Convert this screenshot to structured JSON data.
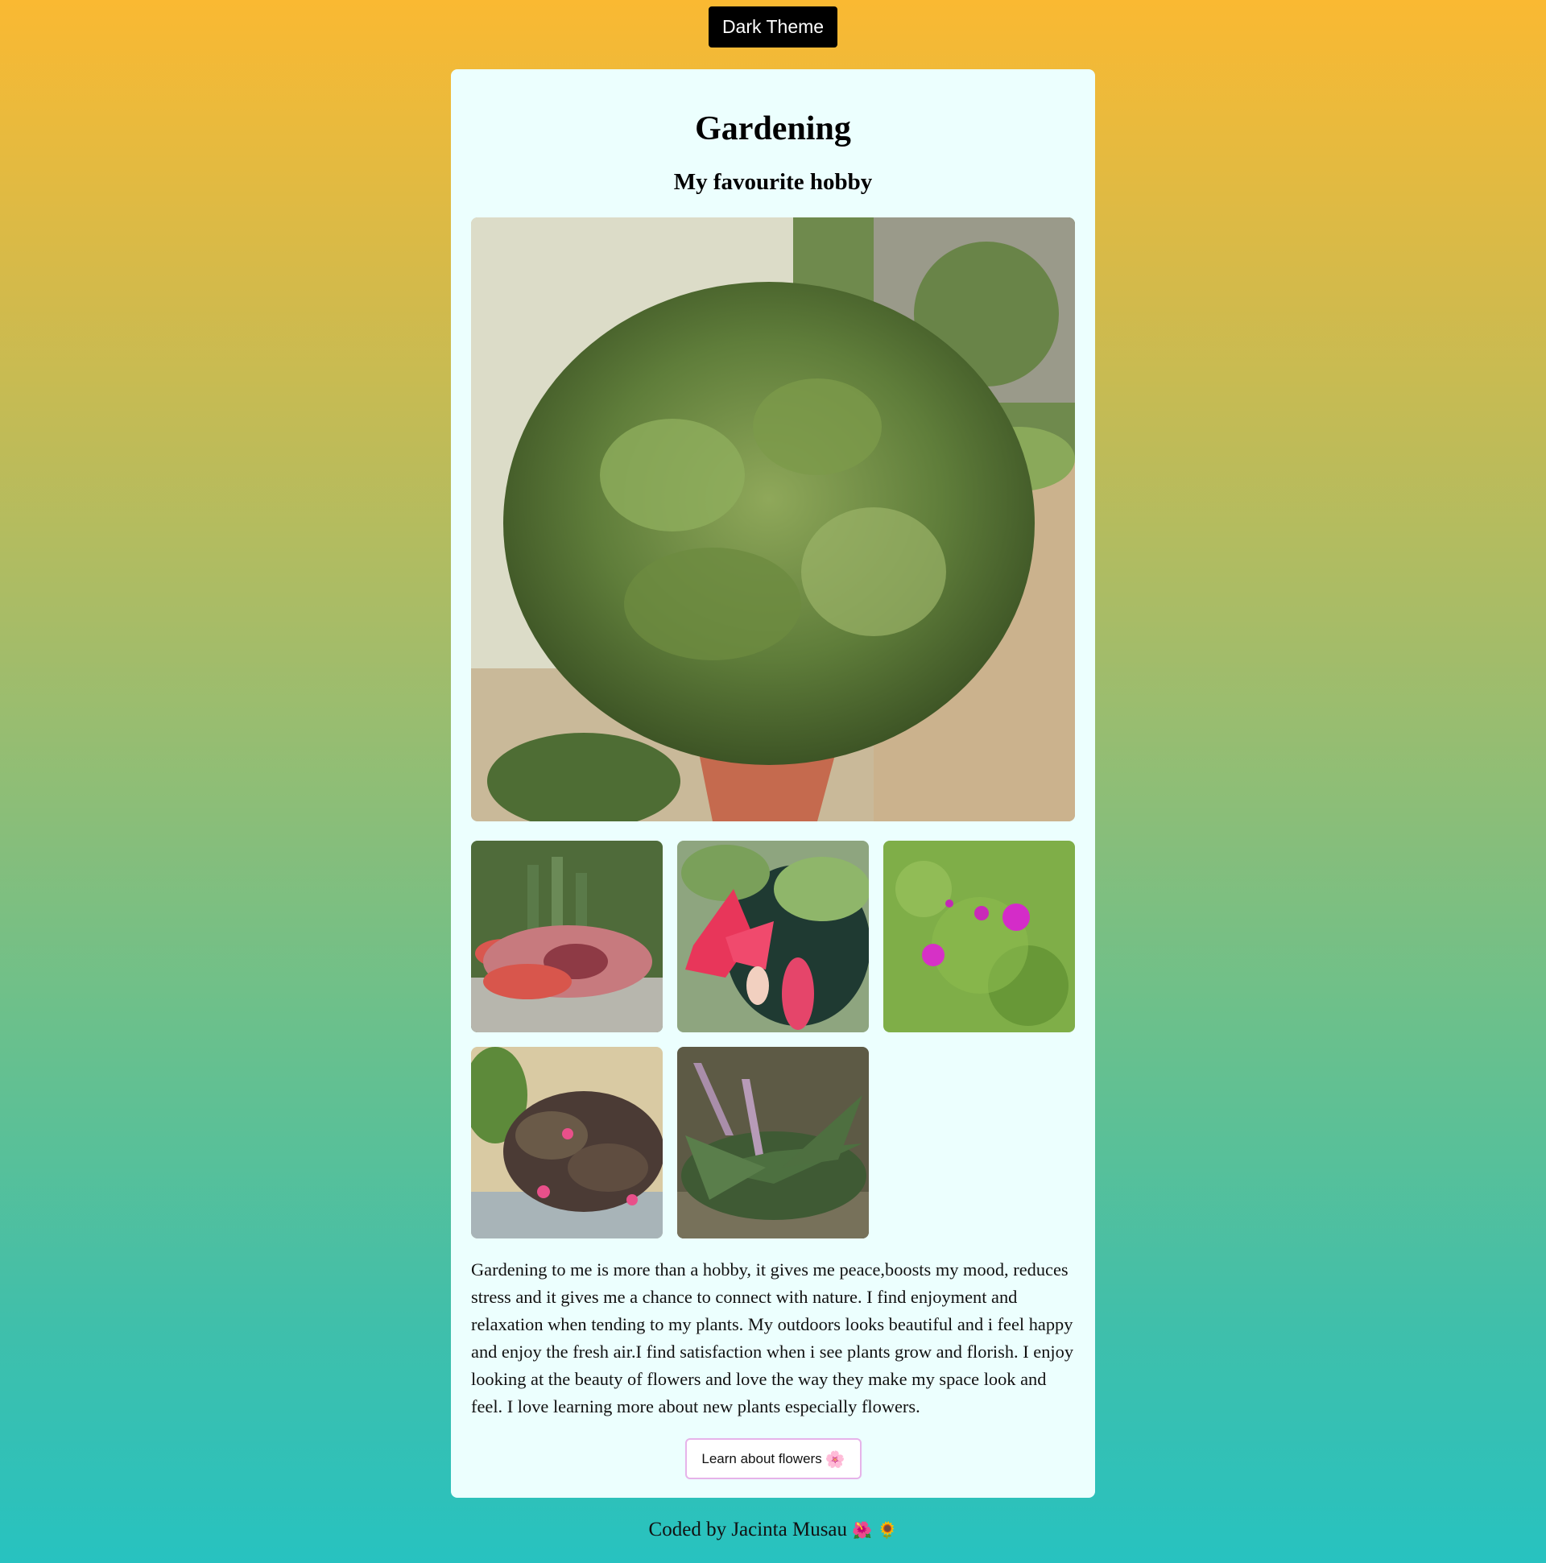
{
  "header": {
    "theme_toggle_label": "Dark Theme"
  },
  "card": {
    "title": "Gardening",
    "subtitle": "My favourite hobby",
    "gallery": [
      {
        "name": "jade-plant-photo"
      },
      {
        "name": "starfish-flower-photo"
      },
      {
        "name": "christmas-cactus-photo"
      },
      {
        "name": "purslane-flowers-photo"
      },
      {
        "name": "episcia-plant-photo"
      },
      {
        "name": "liriope-plant-photo"
      }
    ],
    "paragraph": "Gardening to me is more than a hobby, it gives me peace,boosts my mood, reduces stress and it gives me a chance to connect with nature. I find enjoyment and relaxation when tending to my plants. My outdoors looks beautiful and i feel happy and enjoy the fresh air.I find satisfaction when i see plants grow and florish. I enjoy looking at the beauty of flowers and love the way they make my space look and feel. I love learning more about new plants especially flowers.",
    "learn_button_label": "Learn about flowers",
    "learn_button_icon": "🌸"
  },
  "footer": {
    "credit": "Coded by Jacinta Musau",
    "icons": "🌺 🌻"
  },
  "colors": {
    "background_top": "#fab932",
    "background_bottom": "#27c2c0",
    "card_background": "#ecfffe",
    "theme_button_bg": "#000000",
    "learn_button_border": "#e6b3e9"
  }
}
